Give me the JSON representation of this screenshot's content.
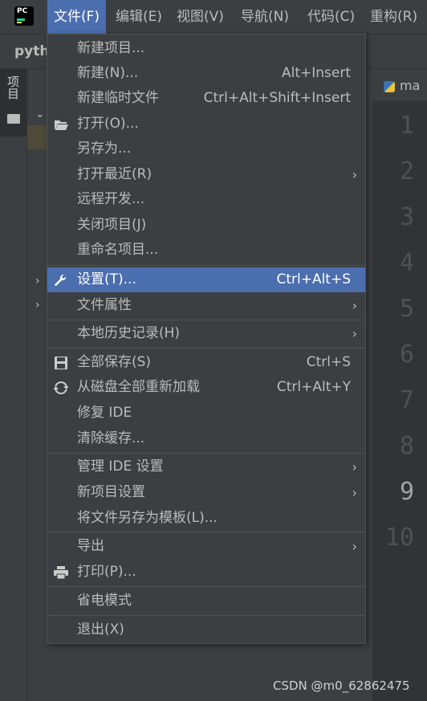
{
  "menubar": {
    "items": [
      "文件(F)",
      "编辑(E)",
      "视图(V)",
      "导航(N)",
      "代码(C)",
      "重构(R)"
    ],
    "active_index": 0
  },
  "toolbar": {
    "project_name": "pyth"
  },
  "project_tool": {
    "label": "项目"
  },
  "editor": {
    "tab_label": "ma",
    "line_numbers": [
      "1",
      "2",
      "3",
      "4",
      "5",
      "6",
      "7",
      "8",
      "9",
      "10"
    ],
    "current_line": "9"
  },
  "file_menu": {
    "new_project": "新建项目...",
    "new": "新建(N)...",
    "new_shortcut": "Alt+Insert",
    "new_scratch": "新建临时文件",
    "new_scratch_shortcut": "Ctrl+Alt+Shift+Insert",
    "open": "打开(O)...",
    "save_as": "另存为...",
    "open_recent": "打开最近(R)",
    "remote_dev": "远程开发...",
    "close_project": "关闭项目(J)",
    "rename_project": "重命名项目...",
    "settings": "设置(T)...",
    "settings_shortcut": "Ctrl+Alt+S",
    "file_properties": "文件属性",
    "local_history": "本地历史记录(H)",
    "save_all": "全部保存(S)",
    "save_all_shortcut": "Ctrl+S",
    "reload_from_disk": "从磁盘全部重新加载",
    "reload_shortcut": "Ctrl+Alt+Y",
    "repair_ide": "修复 IDE",
    "invalidate_caches": "清除缓存...",
    "manage_ide_settings": "管理 IDE 设置",
    "new_project_settings": "新项目设置",
    "save_as_template": "将文件另存为模板(L)...",
    "export": "导出",
    "print": "打印(P)...",
    "power_save": "省电模式",
    "exit": "退出(X)"
  },
  "icons": {
    "folder": "folder-open-icon",
    "settings": "wrench-icon",
    "save": "floppy-disk-icon",
    "reload": "refresh-icon",
    "print": "printer-icon",
    "submenu": "chevron-right-icon"
  },
  "colors": {
    "accent": "#4b6eaf",
    "background": "#3c3f41"
  },
  "watermark": "CSDN @m0_62862475"
}
